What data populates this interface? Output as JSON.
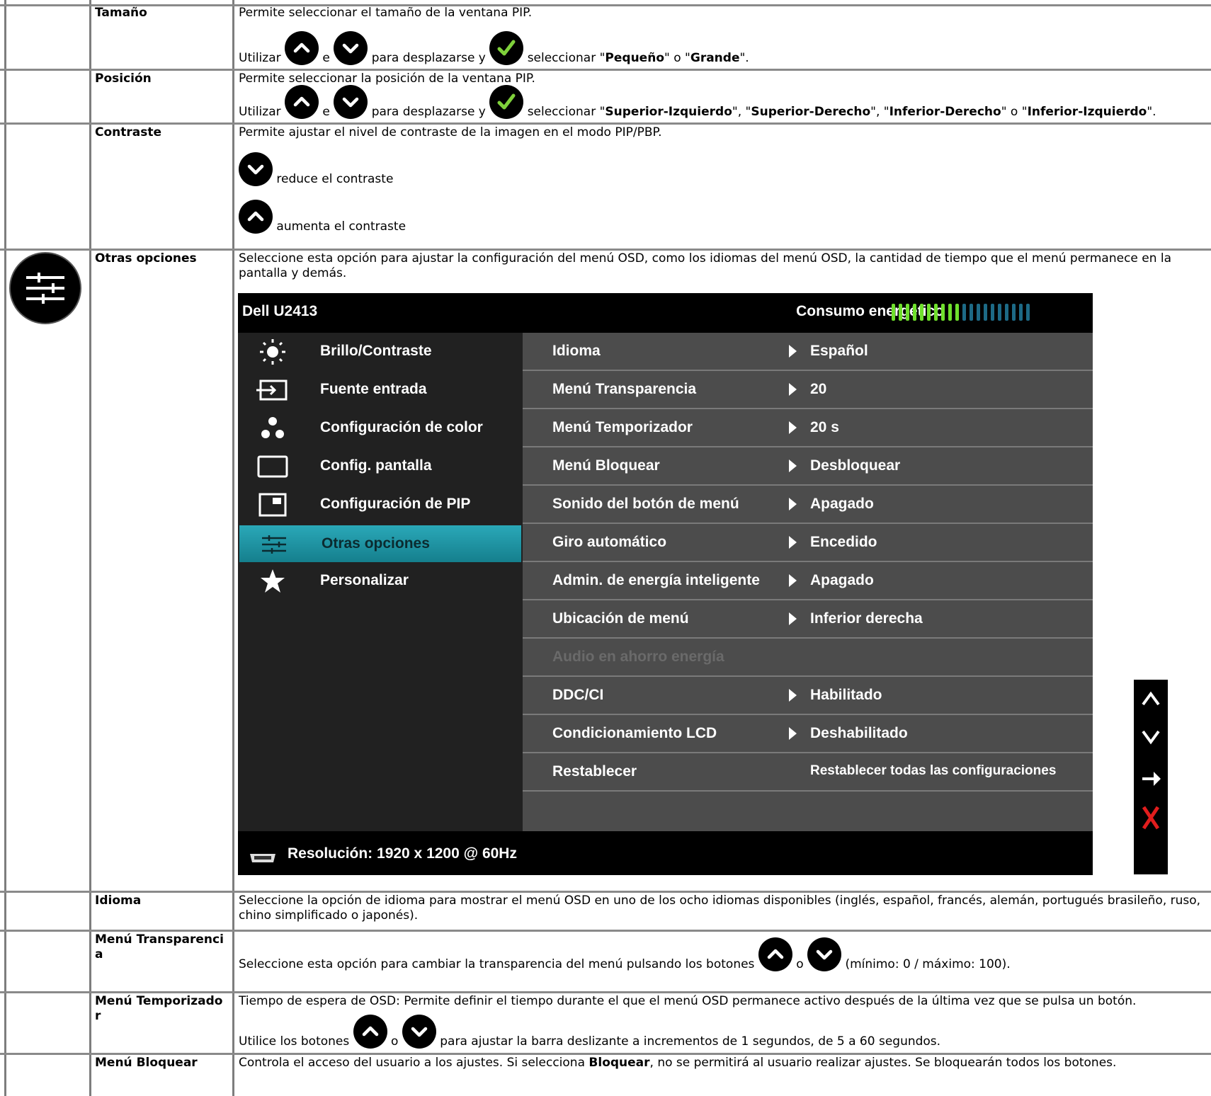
{
  "rows": {
    "tamano": {
      "name": "Tamaño",
      "desc": "Permite seleccionar el tamaño de la ventana PIP.",
      "u1": "Utilizar",
      "u2": "e",
      "u3": "para desplazarse y",
      "u4": "seleccionar \"",
      "b1": "Pequeño",
      "m1": "\" o \"",
      "b2": "Grande",
      "end": "\"."
    },
    "posicion": {
      "name": "Posición",
      "desc": "Permite seleccionar la posición de la ventana PIP.",
      "u1": "Utilizar",
      "u2": "e",
      "u3": "para desplazarse y",
      "u4": "seleccionar \"",
      "b1": "Superior-Izquierdo",
      "m1": "\", \"",
      "b2": "Superior-Derecho",
      "m2": "\", \"",
      "b3": "Inferior-Derecho",
      "m3": "\" o \"",
      "b4": "Inferior-Izquierdo",
      "end": "\"."
    },
    "contraste": {
      "name": "Contraste",
      "desc": "Permite ajustar el nivel de contraste de la imagen en el modo PIP/PBP.",
      "down": "reduce el contraste",
      "up": "aumenta el contraste"
    },
    "otras": {
      "name": "Otras opciones",
      "desc": "Seleccione esta opción para ajustar la configuración del menú OSD, como los idiomas del menú OSD, la cantidad de tiempo que el menú permanece en la pantalla y demás."
    },
    "idioma": {
      "name": "Idioma",
      "desc": "Seleccione la opción de idioma para mostrar el menú OSD en uno de los ocho idiomas disponibles (inglés, español, francés, alemán, portugués brasileño, ruso, chino simplificado o japonés)."
    },
    "transparencia": {
      "name": "Menú Transparencia",
      "t1": "Seleccione esta opción para cambiar la transparencia del menú pulsando los botones",
      "t2": "o",
      "t3": "(mínimo: 0 / máximo: 100)."
    },
    "temporizador": {
      "name": "Menú Temporizador",
      "desc": "Tiempo de espera de OSD: Permite definir el tiempo durante el que el menú OSD permanece activo después de la última vez que se pulsa un botón.",
      "t1": "Utilice los botones",
      "t2": "o",
      "t3": "para ajustar la barra deslizante a incrementos de 1 segundos, de 5 a 60 segundos."
    },
    "bloquear": {
      "name": "Menú Bloquear",
      "d1": "Controla el acceso del usuario a los ajustes. Si selecciona",
      "b1": "Bloquear",
      "d2": ", no se permitirá al usuario realizar ajustes. Se bloquearán todos los botones."
    }
  },
  "osd": {
    "title": "Dell U2413",
    "power_label": "Consumo energético",
    "power_level_fraction": 0.5,
    "menu": [
      {
        "label": "Brillo/Contraste",
        "icon": "brightness-icon"
      },
      {
        "label": "Fuente entrada",
        "icon": "input-source-icon"
      },
      {
        "label": "Configuración de color",
        "icon": "color-dots-icon"
      },
      {
        "label": "Config. pantalla",
        "icon": "display-icon"
      },
      {
        "label": "Configuración de PIP",
        "icon": "pip-icon"
      },
      {
        "label": "Otras opciones",
        "icon": "sliders-icon",
        "selected": true
      },
      {
        "label": "Personalizar",
        "icon": "star-icon"
      }
    ],
    "options": [
      {
        "key": "Idioma",
        "value": "Español"
      },
      {
        "key": "Menú Transparencia",
        "value": "20"
      },
      {
        "key": "Menú Temporizador",
        "value": "20 s"
      },
      {
        "key": "Menú Bloquear",
        "value": "Desbloquear"
      },
      {
        "key": "Sonido del botón de menú",
        "value": "Apagado"
      },
      {
        "key": "Giro automático",
        "value": "Encedido"
      },
      {
        "key": "Admin. de energía inteligente",
        "value": "Apagado"
      },
      {
        "key": "Ubicación de menú",
        "value": "Inferior derecha"
      },
      {
        "key": "Audio en ahorro energía",
        "value": "",
        "disabled": true
      },
      {
        "key": "DDC/CI",
        "value": "Habilitado"
      },
      {
        "key": "Condicionamiento LCD",
        "value": "Deshabilitado"
      },
      {
        "key": "Restablecer",
        "value": "Restablecer todas las configuraciones",
        "noarrow": true
      }
    ],
    "footer": "Resolución: 1920 x 1200 @ 60Hz"
  },
  "colors": {
    "check_green": "#7fd13b",
    "selected_teal": "#1f96a6",
    "exit_red": "#e11d1d",
    "osd_right_bg": "#4c4c4c",
    "osd_left_bg": "#212121"
  }
}
